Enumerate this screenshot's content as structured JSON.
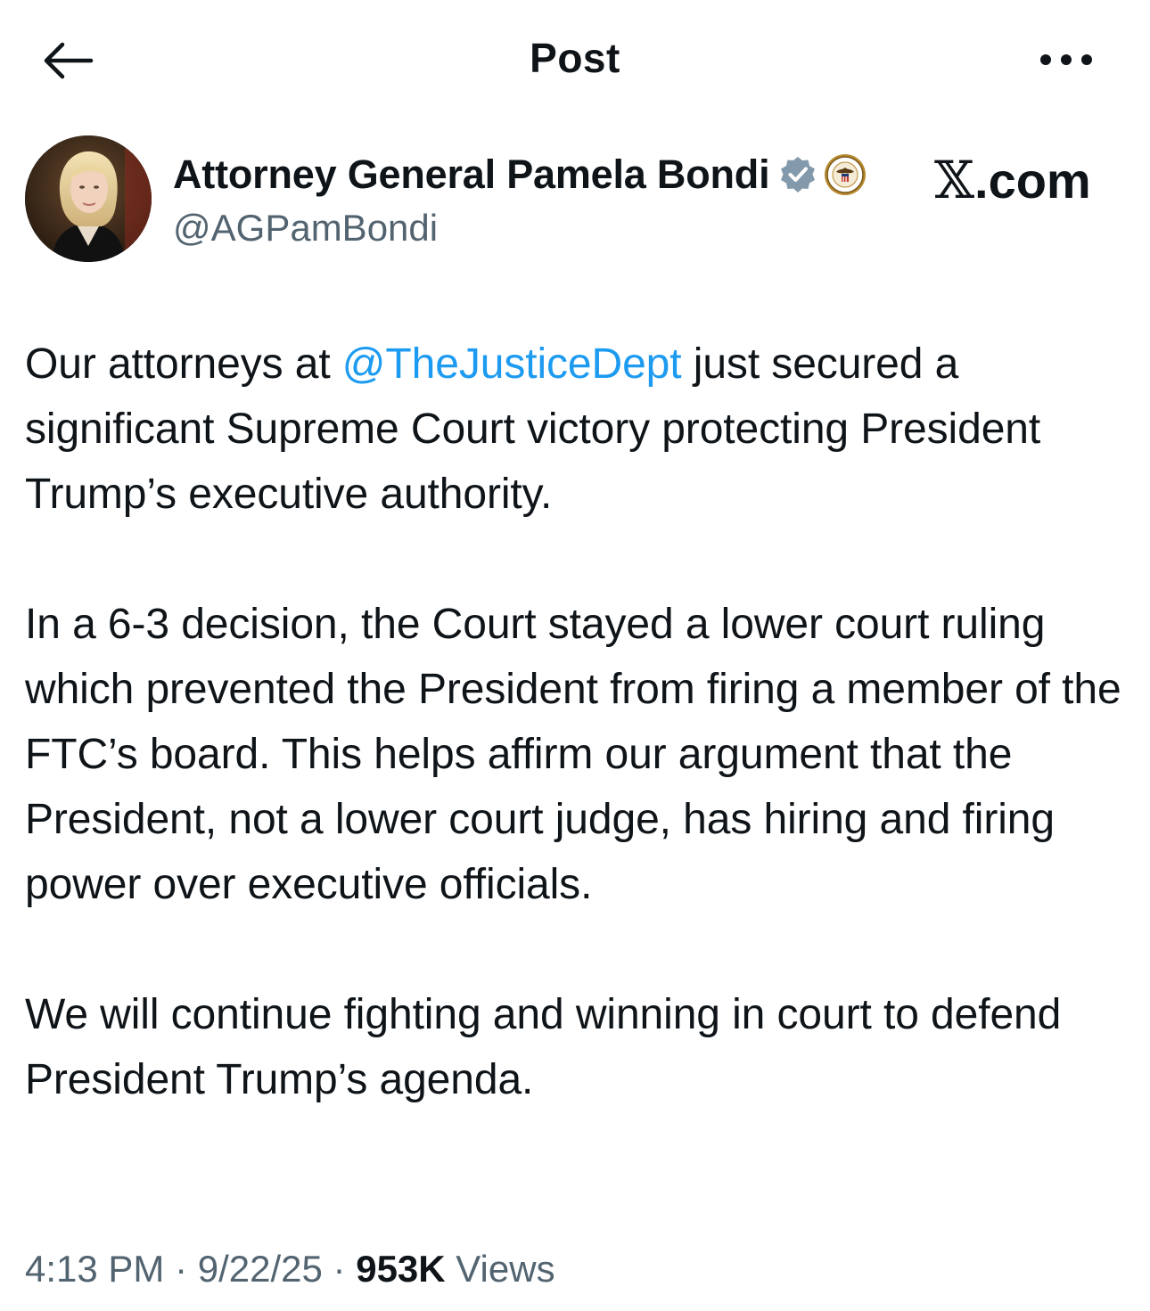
{
  "header": {
    "title": "Post",
    "back_icon": "arrow-left-icon",
    "more_icon": "more-horizontal-icon"
  },
  "author": {
    "display_name": "Attorney General Pamela Bondi",
    "handle": "@AGPamBondi",
    "verified_badge": "verified-badge-icon",
    "affiliation_badge": "doj-seal-icon",
    "avatar": "avatar-photo"
  },
  "watermark": {
    "x_letter": "𝕏",
    "domain": ".com"
  },
  "post": {
    "p1_before": "Our attorneys at ",
    "p1_mention": "@TheJusticeDept",
    "p1_after": " just secured a significant Supreme Court victory protecting President Trump’s executive authority.",
    "p2": "In a 6-3 decision, the Court stayed a lower court ruling which prevented the President from firing a member of the FTC’s board. This helps affirm our argument that the President, not a lower court judge, has hiring and firing power over executive officials.",
    "p3": "We will continue fighting and winning in court to defend President Trump’s agenda."
  },
  "meta": {
    "time": "4:13 PM",
    "separator": " · ",
    "date": "9/22/25",
    "views_count": "953K",
    "views_label": " Views"
  },
  "colors": {
    "text": "#0f1419",
    "secondary": "#536471",
    "link": "#1d9bf0",
    "verified_badge": "#829aab"
  }
}
